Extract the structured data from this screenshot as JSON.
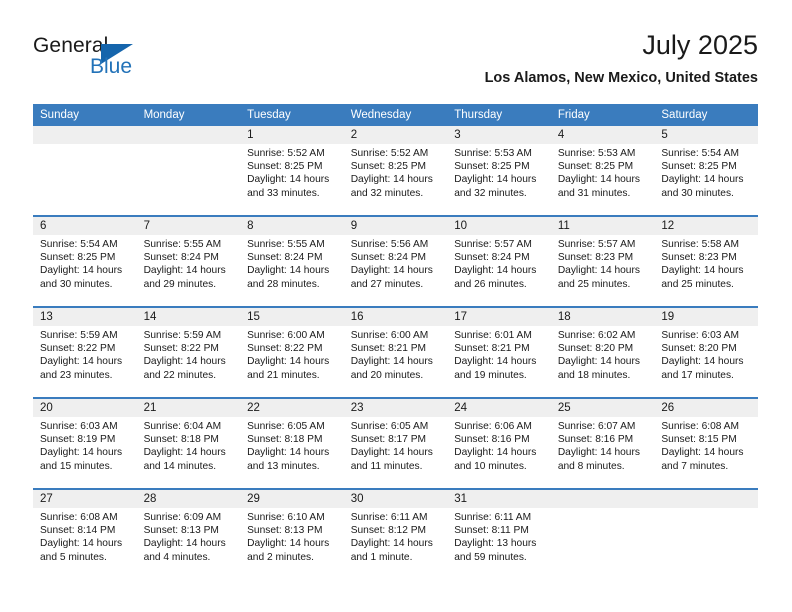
{
  "brand": {
    "name_part1": "General",
    "name_part2": "Blue",
    "accent_color": "#2272b8",
    "triangle_color": "#1565ac"
  },
  "header": {
    "title": "July 2025",
    "subtitle": "Los Alamos, New Mexico, United States"
  },
  "theme": {
    "header_blue": "#3a7cbe",
    "daynum_band": "#efefef"
  },
  "weekday_headers": [
    "Sunday",
    "Monday",
    "Tuesday",
    "Wednesday",
    "Thursday",
    "Friday",
    "Saturday"
  ],
  "weeks": [
    [
      {
        "day": "",
        "sunrise": "",
        "sunset": "",
        "daylight_line1": "",
        "daylight_line2": ""
      },
      {
        "day": "",
        "sunrise": "",
        "sunset": "",
        "daylight_line1": "",
        "daylight_line2": ""
      },
      {
        "day": "1",
        "sunrise": "Sunrise: 5:52 AM",
        "sunset": "Sunset: 8:25 PM",
        "daylight_line1": "Daylight: 14 hours",
        "daylight_line2": "and 33 minutes."
      },
      {
        "day": "2",
        "sunrise": "Sunrise: 5:52 AM",
        "sunset": "Sunset: 8:25 PM",
        "daylight_line1": "Daylight: 14 hours",
        "daylight_line2": "and 32 minutes."
      },
      {
        "day": "3",
        "sunrise": "Sunrise: 5:53 AM",
        "sunset": "Sunset: 8:25 PM",
        "daylight_line1": "Daylight: 14 hours",
        "daylight_line2": "and 32 minutes."
      },
      {
        "day": "4",
        "sunrise": "Sunrise: 5:53 AM",
        "sunset": "Sunset: 8:25 PM",
        "daylight_line1": "Daylight: 14 hours",
        "daylight_line2": "and 31 minutes."
      },
      {
        "day": "5",
        "sunrise": "Sunrise: 5:54 AM",
        "sunset": "Sunset: 8:25 PM",
        "daylight_line1": "Daylight: 14 hours",
        "daylight_line2": "and 30 minutes."
      }
    ],
    [
      {
        "day": "6",
        "sunrise": "Sunrise: 5:54 AM",
        "sunset": "Sunset: 8:25 PM",
        "daylight_line1": "Daylight: 14 hours",
        "daylight_line2": "and 30 minutes."
      },
      {
        "day": "7",
        "sunrise": "Sunrise: 5:55 AM",
        "sunset": "Sunset: 8:24 PM",
        "daylight_line1": "Daylight: 14 hours",
        "daylight_line2": "and 29 minutes."
      },
      {
        "day": "8",
        "sunrise": "Sunrise: 5:55 AM",
        "sunset": "Sunset: 8:24 PM",
        "daylight_line1": "Daylight: 14 hours",
        "daylight_line2": "and 28 minutes."
      },
      {
        "day": "9",
        "sunrise": "Sunrise: 5:56 AM",
        "sunset": "Sunset: 8:24 PM",
        "daylight_line1": "Daylight: 14 hours",
        "daylight_line2": "and 27 minutes."
      },
      {
        "day": "10",
        "sunrise": "Sunrise: 5:57 AM",
        "sunset": "Sunset: 8:24 PM",
        "daylight_line1": "Daylight: 14 hours",
        "daylight_line2": "and 26 minutes."
      },
      {
        "day": "11",
        "sunrise": "Sunrise: 5:57 AM",
        "sunset": "Sunset: 8:23 PM",
        "daylight_line1": "Daylight: 14 hours",
        "daylight_line2": "and 25 minutes."
      },
      {
        "day": "12",
        "sunrise": "Sunrise: 5:58 AM",
        "sunset": "Sunset: 8:23 PM",
        "daylight_line1": "Daylight: 14 hours",
        "daylight_line2": "and 25 minutes."
      }
    ],
    [
      {
        "day": "13",
        "sunrise": "Sunrise: 5:59 AM",
        "sunset": "Sunset: 8:22 PM",
        "daylight_line1": "Daylight: 14 hours",
        "daylight_line2": "and 23 minutes."
      },
      {
        "day": "14",
        "sunrise": "Sunrise: 5:59 AM",
        "sunset": "Sunset: 8:22 PM",
        "daylight_line1": "Daylight: 14 hours",
        "daylight_line2": "and 22 minutes."
      },
      {
        "day": "15",
        "sunrise": "Sunrise: 6:00 AM",
        "sunset": "Sunset: 8:22 PM",
        "daylight_line1": "Daylight: 14 hours",
        "daylight_line2": "and 21 minutes."
      },
      {
        "day": "16",
        "sunrise": "Sunrise: 6:00 AM",
        "sunset": "Sunset: 8:21 PM",
        "daylight_line1": "Daylight: 14 hours",
        "daylight_line2": "and 20 minutes."
      },
      {
        "day": "17",
        "sunrise": "Sunrise: 6:01 AM",
        "sunset": "Sunset: 8:21 PM",
        "daylight_line1": "Daylight: 14 hours",
        "daylight_line2": "and 19 minutes."
      },
      {
        "day": "18",
        "sunrise": "Sunrise: 6:02 AM",
        "sunset": "Sunset: 8:20 PM",
        "daylight_line1": "Daylight: 14 hours",
        "daylight_line2": "and 18 minutes."
      },
      {
        "day": "19",
        "sunrise": "Sunrise: 6:03 AM",
        "sunset": "Sunset: 8:20 PM",
        "daylight_line1": "Daylight: 14 hours",
        "daylight_line2": "and 17 minutes."
      }
    ],
    [
      {
        "day": "20",
        "sunrise": "Sunrise: 6:03 AM",
        "sunset": "Sunset: 8:19 PM",
        "daylight_line1": "Daylight: 14 hours",
        "daylight_line2": "and 15 minutes."
      },
      {
        "day": "21",
        "sunrise": "Sunrise: 6:04 AM",
        "sunset": "Sunset: 8:18 PM",
        "daylight_line1": "Daylight: 14 hours",
        "daylight_line2": "and 14 minutes."
      },
      {
        "day": "22",
        "sunrise": "Sunrise: 6:05 AM",
        "sunset": "Sunset: 8:18 PM",
        "daylight_line1": "Daylight: 14 hours",
        "daylight_line2": "and 13 minutes."
      },
      {
        "day": "23",
        "sunrise": "Sunrise: 6:05 AM",
        "sunset": "Sunset: 8:17 PM",
        "daylight_line1": "Daylight: 14 hours",
        "daylight_line2": "and 11 minutes."
      },
      {
        "day": "24",
        "sunrise": "Sunrise: 6:06 AM",
        "sunset": "Sunset: 8:16 PM",
        "daylight_line1": "Daylight: 14 hours",
        "daylight_line2": "and 10 minutes."
      },
      {
        "day": "25",
        "sunrise": "Sunrise: 6:07 AM",
        "sunset": "Sunset: 8:16 PM",
        "daylight_line1": "Daylight: 14 hours",
        "daylight_line2": "and 8 minutes."
      },
      {
        "day": "26",
        "sunrise": "Sunrise: 6:08 AM",
        "sunset": "Sunset: 8:15 PM",
        "daylight_line1": "Daylight: 14 hours",
        "daylight_line2": "and 7 minutes."
      }
    ],
    [
      {
        "day": "27",
        "sunrise": "Sunrise: 6:08 AM",
        "sunset": "Sunset: 8:14 PM",
        "daylight_line1": "Daylight: 14 hours",
        "daylight_line2": "and 5 minutes."
      },
      {
        "day": "28",
        "sunrise": "Sunrise: 6:09 AM",
        "sunset": "Sunset: 8:13 PM",
        "daylight_line1": "Daylight: 14 hours",
        "daylight_line2": "and 4 minutes."
      },
      {
        "day": "29",
        "sunrise": "Sunrise: 6:10 AM",
        "sunset": "Sunset: 8:13 PM",
        "daylight_line1": "Daylight: 14 hours",
        "daylight_line2": "and 2 minutes."
      },
      {
        "day": "30",
        "sunrise": "Sunrise: 6:11 AM",
        "sunset": "Sunset: 8:12 PM",
        "daylight_line1": "Daylight: 14 hours",
        "daylight_line2": "and 1 minute."
      },
      {
        "day": "31",
        "sunrise": "Sunrise: 6:11 AM",
        "sunset": "Sunset: 8:11 PM",
        "daylight_line1": "Daylight: 13 hours",
        "daylight_line2": "and 59 minutes."
      },
      {
        "day": "",
        "sunrise": "",
        "sunset": "",
        "daylight_line1": "",
        "daylight_line2": ""
      },
      {
        "day": "",
        "sunrise": "",
        "sunset": "",
        "daylight_line1": "",
        "daylight_line2": ""
      }
    ]
  ]
}
